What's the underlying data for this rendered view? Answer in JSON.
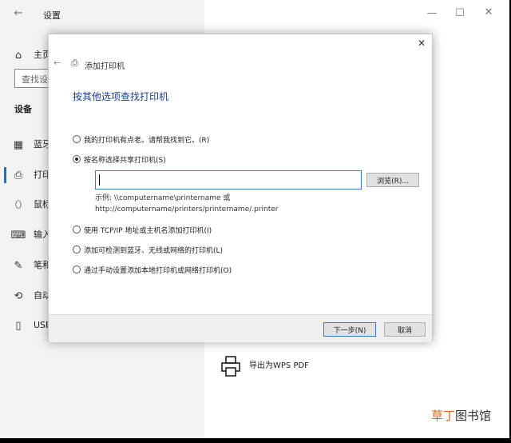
{
  "settings": {
    "title": "设置",
    "home_label": "主页",
    "search_placeholder": "查找设",
    "section_title": "设备",
    "nav_items": [
      {
        "label": "蓝牙",
        "icon": "bluetooth-icon"
      },
      {
        "label": "打印",
        "icon": "printer-icon"
      },
      {
        "label": "鼠标",
        "icon": "mouse-icon"
      },
      {
        "label": "输入",
        "icon": "keyboard-icon"
      },
      {
        "label": "笔和",
        "icon": "pen-icon"
      },
      {
        "label": "自动",
        "icon": "autoplay-icon"
      },
      {
        "label": "USB",
        "icon": "usb-icon"
      }
    ],
    "printer_entry": "导出为WPS PDF"
  },
  "dialog": {
    "title": "添加打印机",
    "heading": "按其他选项查找打印机",
    "options": [
      {
        "label": "我的打印机有点老。请帮我找到它。(R)",
        "checked": false
      },
      {
        "label": "按名称选择共享打印机(S)",
        "checked": true
      },
      {
        "label": "使用 TCP/IP 地址或主机名添加打印机(I)",
        "checked": false
      },
      {
        "label": "添加可检测到蓝牙、无线或网络的打印机(L)",
        "checked": false
      },
      {
        "label": "通过手动设置添加本地打印机或网络打印机(O)",
        "checked": false
      }
    ],
    "input_value": "",
    "browse_label": "浏览(R)...",
    "example_line1": "示例: \\\\computername\\printername 或",
    "example_line2": "http://computername/printers/printername/.printer",
    "next_label": "下一步(N)",
    "cancel_label": "取消"
  },
  "watermark": {
    "part1": "草丁",
    "part2": "图书馆"
  },
  "colors": {
    "accent": "#3b78d8",
    "heading": "#1a3f8f",
    "watermark_orange": "#e0641f"
  }
}
